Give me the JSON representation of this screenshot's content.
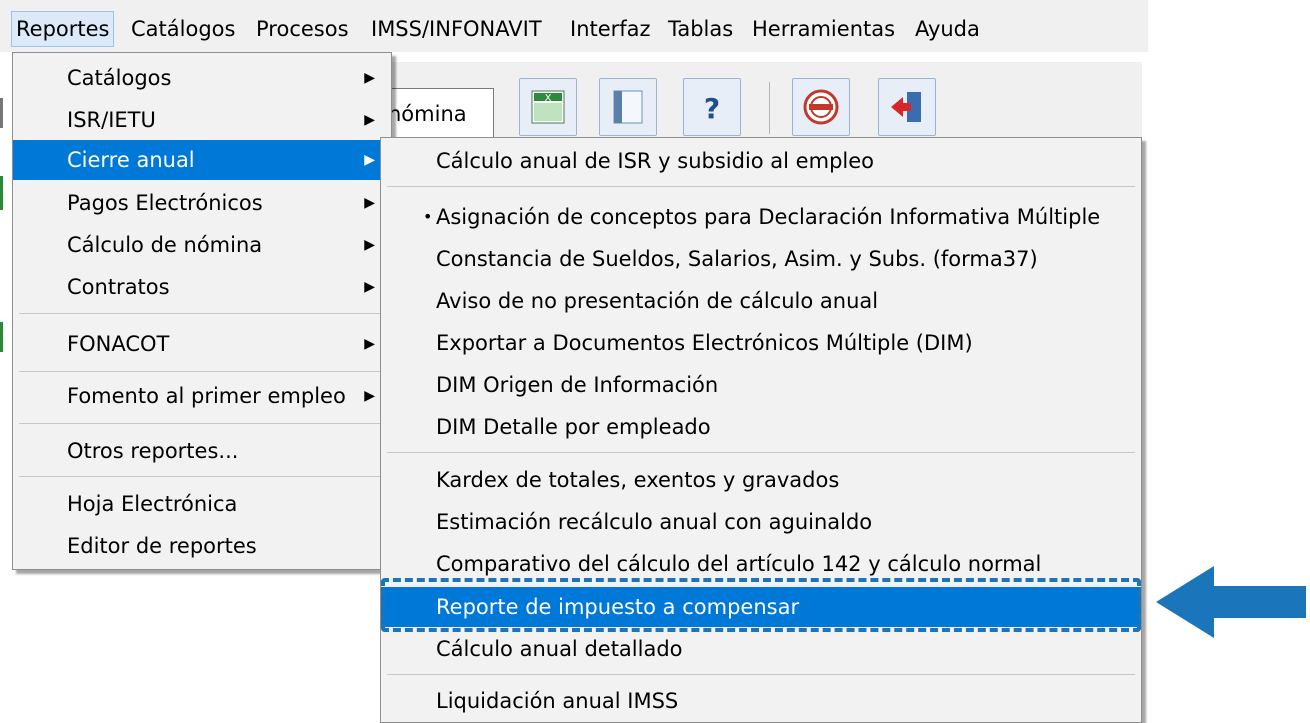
{
  "menubar": {
    "items": [
      {
        "label": "Reportes",
        "active": true
      },
      {
        "label": "Catálogos"
      },
      {
        "label": "Procesos"
      },
      {
        "label": "IMSS/INFONAVIT"
      },
      {
        "label": "Interfaz"
      },
      {
        "label": "Tablas"
      },
      {
        "label": "Herramientas"
      },
      {
        "label": "Ayuda"
      }
    ]
  },
  "toolbar": {
    "combo_text": "nómina",
    "buttons": [
      "excel-icon",
      "panel-icon",
      "help-icon",
      "imss-icon",
      "exit-icon"
    ]
  },
  "reportes_menu": {
    "items": [
      {
        "label": "Catálogos",
        "submenu": true
      },
      {
        "label": "ISR/IETU",
        "submenu": true
      },
      {
        "label": "Cierre anual",
        "submenu": true,
        "highlighted": true
      },
      {
        "label": "Pagos Electrónicos",
        "submenu": true
      },
      {
        "label": "Cálculo de nómina",
        "submenu": true
      },
      {
        "label": "Contratos",
        "submenu": true
      },
      {
        "label": "FONACOT",
        "submenu": true
      },
      {
        "label": "Fomento al primer empleo",
        "submenu": true
      },
      {
        "label": "Otros reportes..."
      },
      {
        "label": "Hoja Electrónica"
      },
      {
        "label": "Editor de reportes"
      }
    ]
  },
  "cierre_menu": {
    "items": [
      {
        "label": "Cálculo anual de ISR y subsidio al empleo"
      },
      {
        "label": "Asignación de conceptos para Declaración Informativa Múltiple",
        "bullet": true
      },
      {
        "label": "Constancia de Sueldos, Salarios, Asim. y Subs. (forma37)"
      },
      {
        "label": "Aviso de no presentación de cálculo anual"
      },
      {
        "label": "Exportar a Documentos Electrónicos Múltiple (DIM)"
      },
      {
        "label": "DIM Origen de Información"
      },
      {
        "label": "DIM Detalle por empleado"
      },
      {
        "label": "Kardex de totales, exentos y gravados"
      },
      {
        "label": "Estimación recálculo anual con aguinaldo"
      },
      {
        "label": "Comparativo del cálculo del artículo 142 y cálculo normal"
      },
      {
        "label": "Reporte de impuesto a compensar",
        "highlighted": true
      },
      {
        "label": "Cálculo anual detallado"
      },
      {
        "label": "Liquidación anual IMSS"
      }
    ]
  },
  "colors": {
    "highlight": "#0078d7",
    "annotation": "#1b75bb"
  }
}
